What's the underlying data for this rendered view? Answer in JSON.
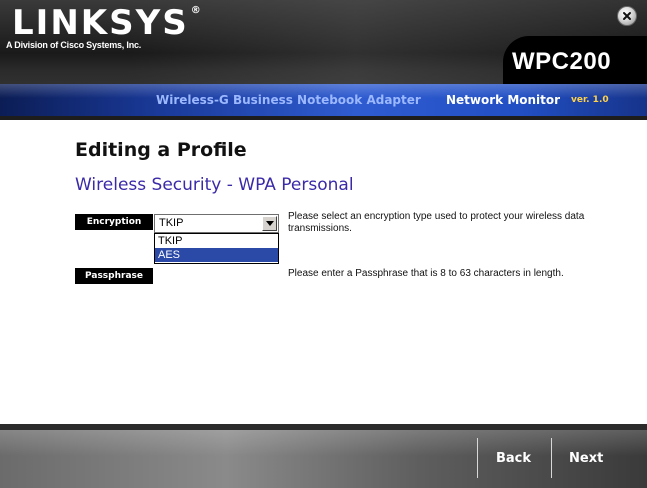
{
  "header": {
    "logo_text": "LINKSYS",
    "tagline": "A Division of Cisco Systems, Inc.",
    "model": "WPC200",
    "product_name": "Wireless-G Business Notebook Adapter",
    "app_name": "Network Monitor",
    "version": "ver. 1.0",
    "close_icon": "close-icon"
  },
  "main": {
    "page_title": "Editing a Profile",
    "section_title": "Wireless Security - WPA Personal",
    "encryption": {
      "label": "Encryption",
      "value": "TKIP",
      "options": [
        "TKIP",
        "AES"
      ],
      "highlighted_option": "AES",
      "help": "Please select an encryption type used to protect your wireless data transmissions."
    },
    "passphrase": {
      "label": "Passphrase",
      "value": "",
      "help": "Please enter a Passphrase that is 8 to 63 characters in length."
    }
  },
  "footer": {
    "back_label": "Back",
    "next_label": "Next"
  },
  "colors": {
    "band_blue": "#2f5cd0",
    "section_title": "#3a2aa8",
    "selected_option": "#2b4aa8",
    "version_text": "#ffd24a"
  }
}
